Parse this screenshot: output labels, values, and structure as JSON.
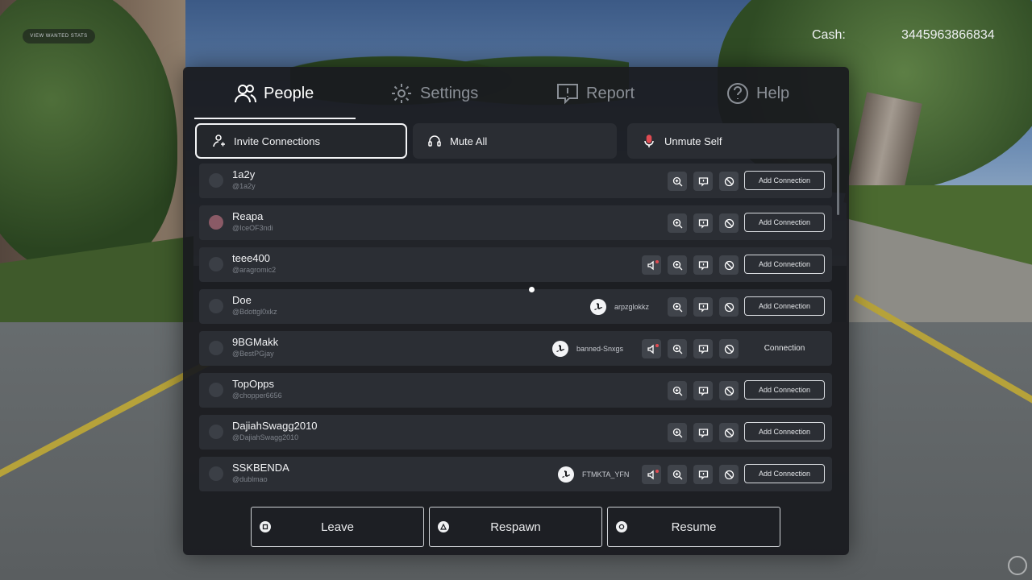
{
  "hud": {
    "wanted_button": "VIEW WANTED STATS",
    "cash_label": "Cash:",
    "cash_value": "3445963866834"
  },
  "tabs": [
    {
      "label": "People",
      "icon": "people-icon",
      "active": true
    },
    {
      "label": "Settings",
      "icon": "gear-icon",
      "active": false
    },
    {
      "label": "Report",
      "icon": "report-icon",
      "active": false
    },
    {
      "label": "Help",
      "icon": "help-icon",
      "active": false
    }
  ],
  "actions": {
    "invite": "Invite Connections",
    "mute_all": "Mute All",
    "unmute_self": "Unmute Self"
  },
  "players": [
    {
      "display_name": "1a2y",
      "username": "@1a2y",
      "action": "Add Connection"
    },
    {
      "display_name": "Reapa",
      "username": "@IceOF3ndi",
      "action": "Add Connection"
    },
    {
      "display_name": "teee400",
      "username": "@aragromic2",
      "action": "Add Connection"
    },
    {
      "display_name": "Doe",
      "username": "@Bdottgl0xkz",
      "platform_name": "arpzglokkz",
      "action": "Add Connection"
    },
    {
      "display_name": "9BGMakk",
      "username": "@BestPGjay",
      "platform_name": "banned-Snxgs",
      "action": "Connection"
    },
    {
      "display_name": "TopOpps",
      "username": "@chopper6656",
      "action": "Add Connection"
    },
    {
      "display_name": "DajiahSwagg2010",
      "username": "@DajiahSwagg2010",
      "action": "Add Connection"
    },
    {
      "display_name": "SSKBENDA",
      "username": "@dublmao",
      "platform_name": "FTMKTA_YFN",
      "action": "Add Connection"
    }
  ],
  "footer": {
    "leave": "Leave",
    "respawn": "Respawn",
    "resume": "Resume"
  },
  "colors": {
    "panel": "#191b1f",
    "row": "#2b2e34",
    "text": "#f3f4f6",
    "muted": "#7e838b",
    "mute_indicator": "#e04b52"
  }
}
